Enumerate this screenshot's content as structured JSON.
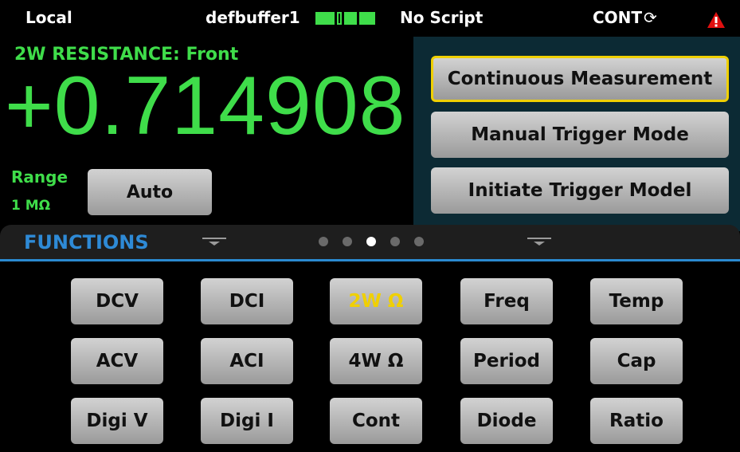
{
  "status": {
    "local": "Local",
    "buffer": "defbuffer1",
    "script": "No Script",
    "cont": "CONT",
    "colors": {
      "buffer_indicator": "#3fdd4a",
      "warning": "#e01010"
    },
    "icons": {
      "buffer": "buffer-indicator-icon",
      "cont": "refresh-icon",
      "warning": "warning-icon"
    }
  },
  "measurement": {
    "title": "2W RESISTANCE: Front",
    "reading": "+0.714908",
    "range_label": "Range",
    "range_value": "1 MΩ",
    "auto_button": "Auto",
    "color": "#3fdd4a"
  },
  "popup": {
    "continuous": "Continuous Measurement",
    "manual": "Manual Trigger Mode",
    "initiate": "Initiate Trigger Model",
    "selected": "Continuous Measurement"
  },
  "functions": {
    "title": "FUNCTIONS",
    "page_count": 5,
    "active_page": 3,
    "selected": "2W Ω",
    "buttons": [
      [
        "DCV",
        "DCI",
        "2W Ω",
        "Freq",
        "Temp"
      ],
      [
        "ACV",
        "ACI",
        "4W Ω",
        "Period",
        "Cap"
      ],
      [
        "Digi V",
        "Digi I",
        "Cont",
        "Diode",
        "Ratio"
      ]
    ]
  }
}
